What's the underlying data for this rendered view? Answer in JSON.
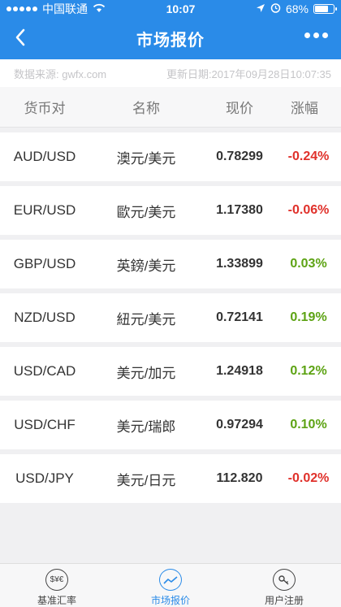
{
  "status": {
    "carrier": "中国联通",
    "time": "10:07",
    "battery": "68%"
  },
  "nav": {
    "title": "市场报价"
  },
  "info": {
    "source": "数据来源: gwfx.com",
    "updated": "更新日期:2017年09月28日10:07:35"
  },
  "header": {
    "pair": "货币对",
    "name": "名称",
    "price": "现价",
    "change": "涨幅"
  },
  "rows": [
    {
      "pair": "AUD/USD",
      "name": "澳元/美元",
      "price": "0.78299",
      "change": "-0.24%",
      "trend": "down"
    },
    {
      "pair": "EUR/USD",
      "name": "歐元/美元",
      "price": "1.17380",
      "change": "-0.06%",
      "trend": "down"
    },
    {
      "pair": "GBP/USD",
      "name": "英鎊/美元",
      "price": "1.33899",
      "change": "0.03%",
      "trend": "up"
    },
    {
      "pair": "NZD/USD",
      "name": "紐元/美元",
      "price": "0.72141",
      "change": "0.19%",
      "trend": "up"
    },
    {
      "pair": "USD/CAD",
      "name": "美元/加元",
      "price": "1.24918",
      "change": "0.12%",
      "trend": "up"
    },
    {
      "pair": "USD/CHF",
      "name": "美元/瑞郎",
      "price": "0.97294",
      "change": "0.10%",
      "trend": "up"
    },
    {
      "pair": "USD/JPY",
      "name": "美元/日元",
      "price": "112.820",
      "change": "-0.02%",
      "trend": "down"
    }
  ],
  "tabs": {
    "base_rate": {
      "label": "基准汇率",
      "icon": "currency-icon"
    },
    "market": {
      "label": "市场报价",
      "icon": "chart-line-icon"
    },
    "register": {
      "label": "用户注册",
      "icon": "key-icon"
    }
  },
  "colors": {
    "accent": "#2a8be8",
    "down": "#e0312b",
    "up": "#5da314"
  }
}
